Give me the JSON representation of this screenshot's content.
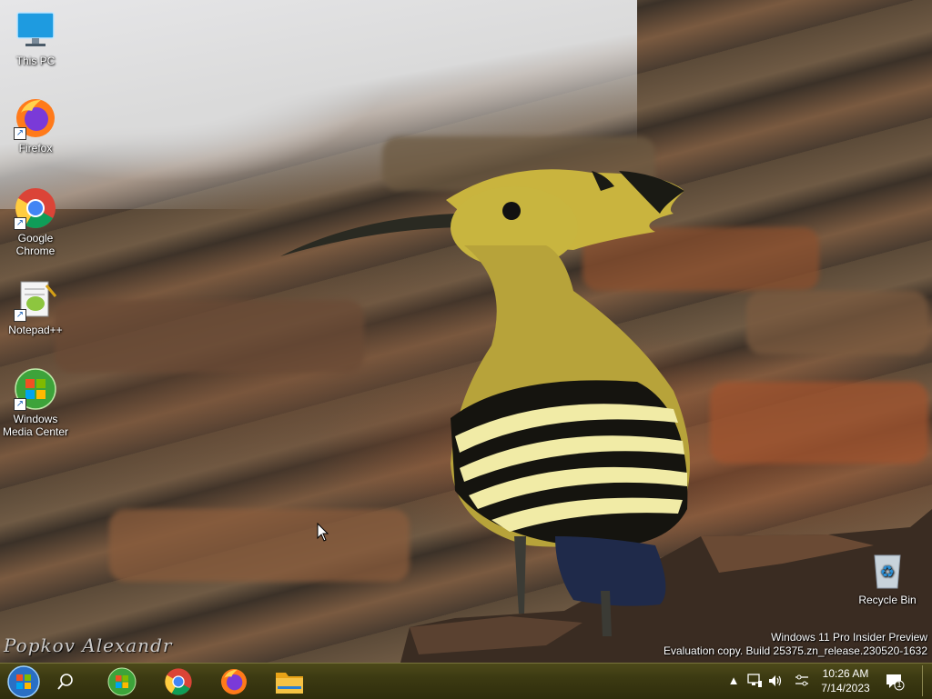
{
  "desktop": {
    "icons": [
      {
        "label": "This PC",
        "icon": "monitor-icon"
      },
      {
        "label": "Firefox",
        "icon": "firefox-icon"
      },
      {
        "label": "Google Chrome",
        "icon": "chrome-icon"
      },
      {
        "label": "Notepad++",
        "icon": "notepadpp-icon"
      },
      {
        "label": "Windows Media Center",
        "icon": "windows-media-center-icon"
      },
      {
        "label": "Recycle Bin",
        "icon": "recycle-bin-icon"
      }
    ],
    "watermark": {
      "line1": "Windows 11 Pro Insider Preview",
      "line2": "Evaluation copy. Build 25375.zn_release.230520-1632"
    },
    "signature": "Popkov Alexandr"
  },
  "taskbar": {
    "start_icon": "windows-orb-icon",
    "search_icon": "search-icon",
    "pinned": [
      {
        "name": "windows-media-center",
        "icon": "windows-media-center-icon"
      },
      {
        "name": "chrome",
        "icon": "chrome-icon"
      },
      {
        "name": "firefox",
        "icon": "firefox-icon"
      },
      {
        "name": "file-explorer",
        "icon": "folder-icon"
      }
    ],
    "tray": {
      "overflow_icon": "chevron-up-icon",
      "network_icon": "network-icon",
      "volume_icon": "volume-icon",
      "settings_icon": "pen-settings-icon",
      "time": "10:26 AM",
      "date": "7/14/2023",
      "notifications_count": "1",
      "notification_icon": "notification-icon"
    }
  },
  "colors": {
    "taskbar": "#3c3a12",
    "text": "#ffffff"
  }
}
